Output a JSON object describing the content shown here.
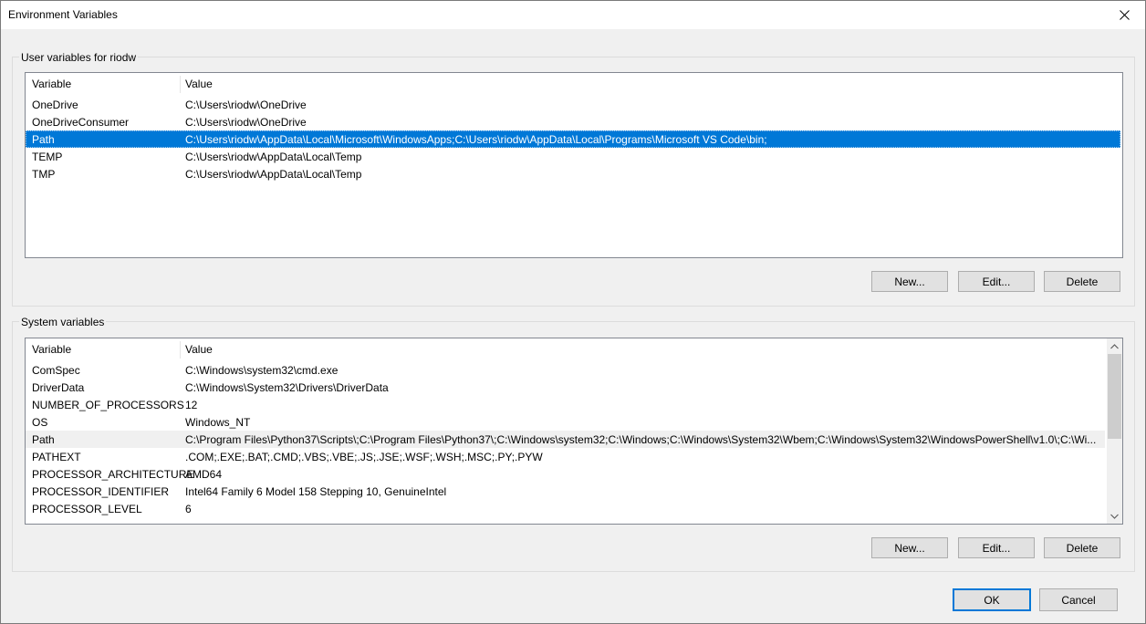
{
  "window": {
    "title": "Environment Variables",
    "close_icon": "close-icon"
  },
  "user_vars": {
    "group_label": "User variables for riodw",
    "columns": [
      "Variable",
      "Value"
    ],
    "rows": [
      {
        "variable": "OneDrive",
        "value": "C:\\Users\\riodw\\OneDrive"
      },
      {
        "variable": "OneDriveConsumer",
        "value": "C:\\Users\\riodw\\OneDrive"
      },
      {
        "variable": "Path",
        "value": "C:\\Users\\riodw\\AppData\\Local\\Microsoft\\WindowsApps;C:\\Users\\riodw\\AppData\\Local\\Programs\\Microsoft VS Code\\bin;"
      },
      {
        "variable": "TEMP",
        "value": "C:\\Users\\riodw\\AppData\\Local\\Temp"
      },
      {
        "variable": "TMP",
        "value": "C:\\Users\\riodw\\AppData\\Local\\Temp"
      }
    ],
    "selected_row": "Path",
    "buttons": {
      "new": "New...",
      "edit": "Edit...",
      "delete": "Delete"
    }
  },
  "system_vars": {
    "group_label": "System variables",
    "columns": [
      "Variable",
      "Value"
    ],
    "rows": [
      {
        "variable": "ComSpec",
        "value": "C:\\Windows\\system32\\cmd.exe"
      },
      {
        "variable": "DriverData",
        "value": "C:\\Windows\\System32\\Drivers\\DriverData"
      },
      {
        "variable": "NUMBER_OF_PROCESSORS",
        "value": "12"
      },
      {
        "variable": "OS",
        "value": "Windows_NT"
      },
      {
        "variable": "Path",
        "value": "C:\\Program Files\\Python37\\Scripts\\;C:\\Program Files\\Python37\\;C:\\Windows\\system32;C:\\Windows;C:\\Windows\\System32\\Wbem;C:\\Windows\\System32\\WindowsPowerShell\\v1.0\\;C:\\Wi..."
      },
      {
        "variable": "PATHEXT",
        "value": ".COM;.EXE;.BAT;.CMD;.VBS;.VBE;.JS;.JSE;.WSF;.WSH;.MSC;.PY;.PYW"
      },
      {
        "variable": "PROCESSOR_ARCHITECTURE",
        "value": "AMD64"
      },
      {
        "variable": "PROCESSOR_IDENTIFIER",
        "value": "Intel64 Family 6 Model 158 Stepping 10, GenuineIntel"
      },
      {
        "variable": "PROCESSOR_LEVEL",
        "value": "6"
      }
    ],
    "focused_row": "Path",
    "buttons": {
      "new": "New...",
      "edit": "Edit...",
      "delete": "Delete"
    }
  },
  "dialog_buttons": {
    "ok": "OK",
    "cancel": "Cancel"
  },
  "colors": {
    "selection": "#0078d7",
    "dialog_bg": "#f0f0f0"
  }
}
